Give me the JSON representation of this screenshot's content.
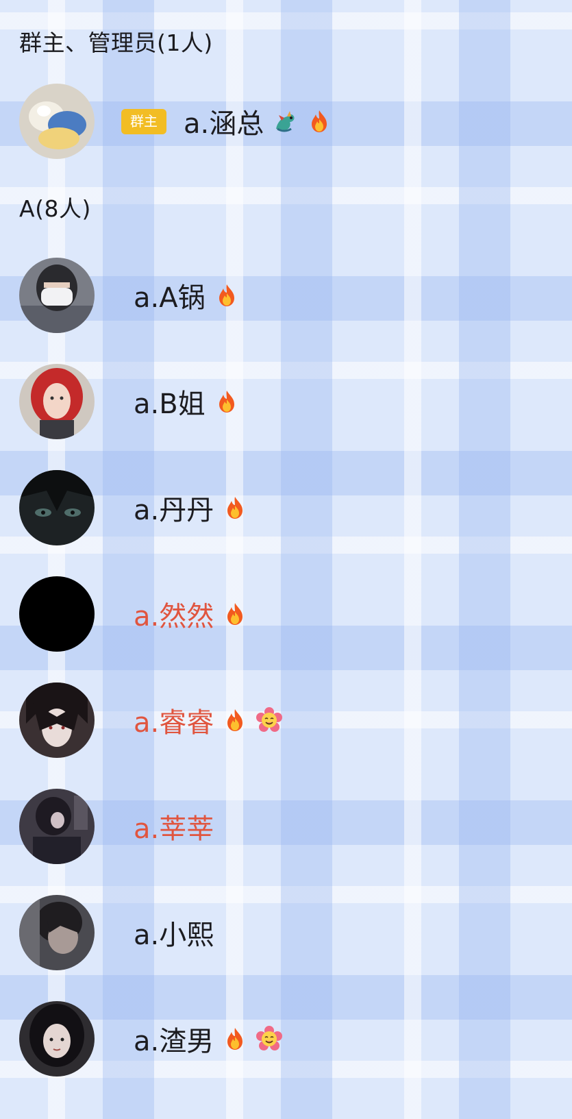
{
  "sections": {
    "admins_header": "群主、管理员(1人)",
    "a_header": "A(8人)"
  },
  "owner": {
    "role_badge": "群主",
    "name": "a.涵总",
    "badges": [
      "dragon-icon",
      "fire-icon"
    ]
  },
  "members": [
    {
      "name": "a.A锅",
      "color": "#1c1c20",
      "badges": [
        "fire-icon"
      ]
    },
    {
      "name": "a.B姐",
      "color": "#1c1c20",
      "badges": [
        "fire-icon"
      ]
    },
    {
      "name": "a.丹丹",
      "color": "#1c1c20",
      "badges": [
        "fire-icon"
      ]
    },
    {
      "name": "a.然然",
      "color": "#e0553f",
      "badges": [
        "fire-icon"
      ]
    },
    {
      "name": "a.睿睿",
      "color": "#e0553f",
      "badges": [
        "fire-icon",
        "flower-icon"
      ]
    },
    {
      "name": "a.莘莘",
      "color": "#e0553f",
      "badges": []
    },
    {
      "name": "a.小熙",
      "color": "#1c1c20",
      "badges": []
    },
    {
      "name": "a.渣男",
      "color": "#1c1c20",
      "badges": [
        "fire-icon",
        "flower-icon"
      ]
    }
  ],
  "colors": {
    "owner_badge": "#f2bd24",
    "highlight_name": "#e0553f",
    "default_name": "#1c1c20",
    "background": "#dde8fb"
  }
}
